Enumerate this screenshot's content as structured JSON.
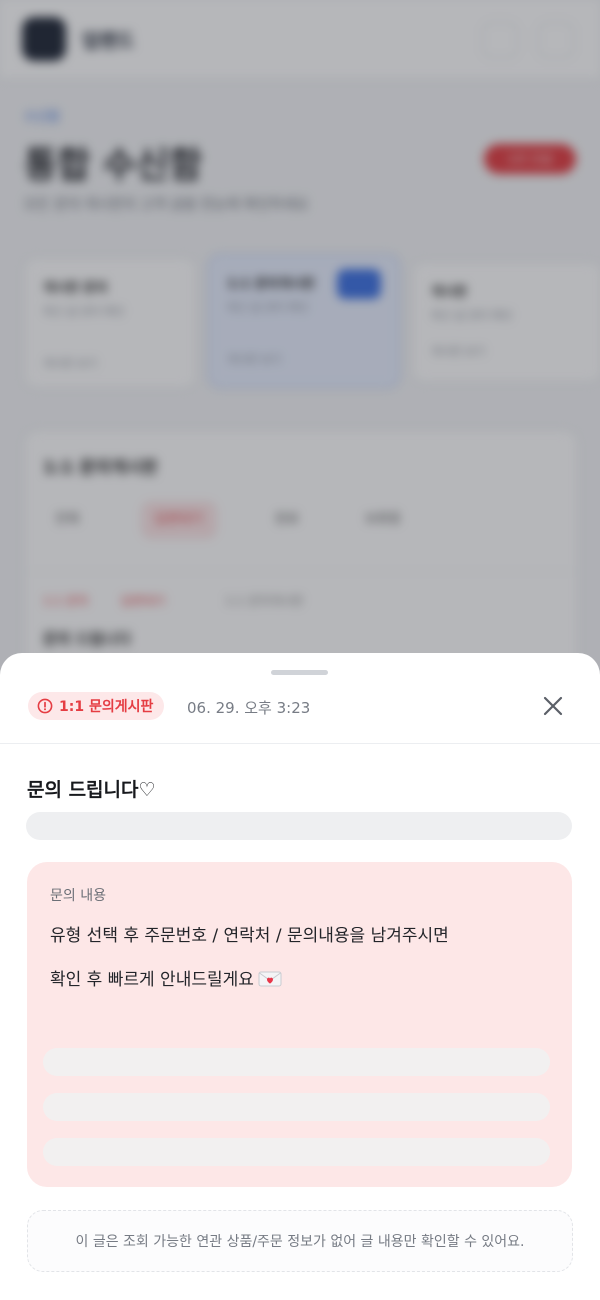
{
  "background": {
    "brand": "업랜드",
    "breadcrumb": "수신함",
    "page_title": "통합 수신함",
    "page_badge": "1건 긴급",
    "subtitle": "모든 문의·게시판의 고객 글을 한눈에 확인하세요",
    "cards": [
      {
        "title": "게시판 문의",
        "sub": "최근 글 관리 확인",
        "foot": "게시판 보기"
      },
      {
        "title": "1:1 문의게시판",
        "sub": "최근 글 관리 확인",
        "foot": "게시판 보기"
      },
      {
        "title": "게시판",
        "sub": "최근 글 관리 확인",
        "foot": "게시판 보기"
      }
    ],
    "panel_title": "1:1 문의게시판",
    "tabs": [
      "전체",
      "답변대기",
      "완료",
      "보류중"
    ],
    "row_tags": [
      "1:1 문의",
      "답변대기",
      "1:1 문의게시판"
    ],
    "row_title": "문의 드립니다"
  },
  "sheet": {
    "badge_label": "1:1 문의게시판",
    "date": "06. 29. 오후 3:23",
    "title": "문의 드립니다♡",
    "content_label": "문의 내용",
    "content_line1": "유형 선택 후 주문번호 / 연락처 / 문의내용을 남겨주시면",
    "content_line2": "확인 후 빠르게 안내드릴게요",
    "notice": "이 글은 조회 가능한 연관 상품/주문 정보가 없어 글 내용만 확인할 수 있어요."
  },
  "colors": {
    "accent_red": "#e53d43",
    "badge_bg": "#fde8e9",
    "content_bg": "#fde7e7",
    "overlay": "rgba(40,44,54,0.34)"
  },
  "icons": {
    "badge_icon": "alert-circle-icon",
    "close_icon": "close-icon",
    "emoji": "love-letter-icon"
  }
}
